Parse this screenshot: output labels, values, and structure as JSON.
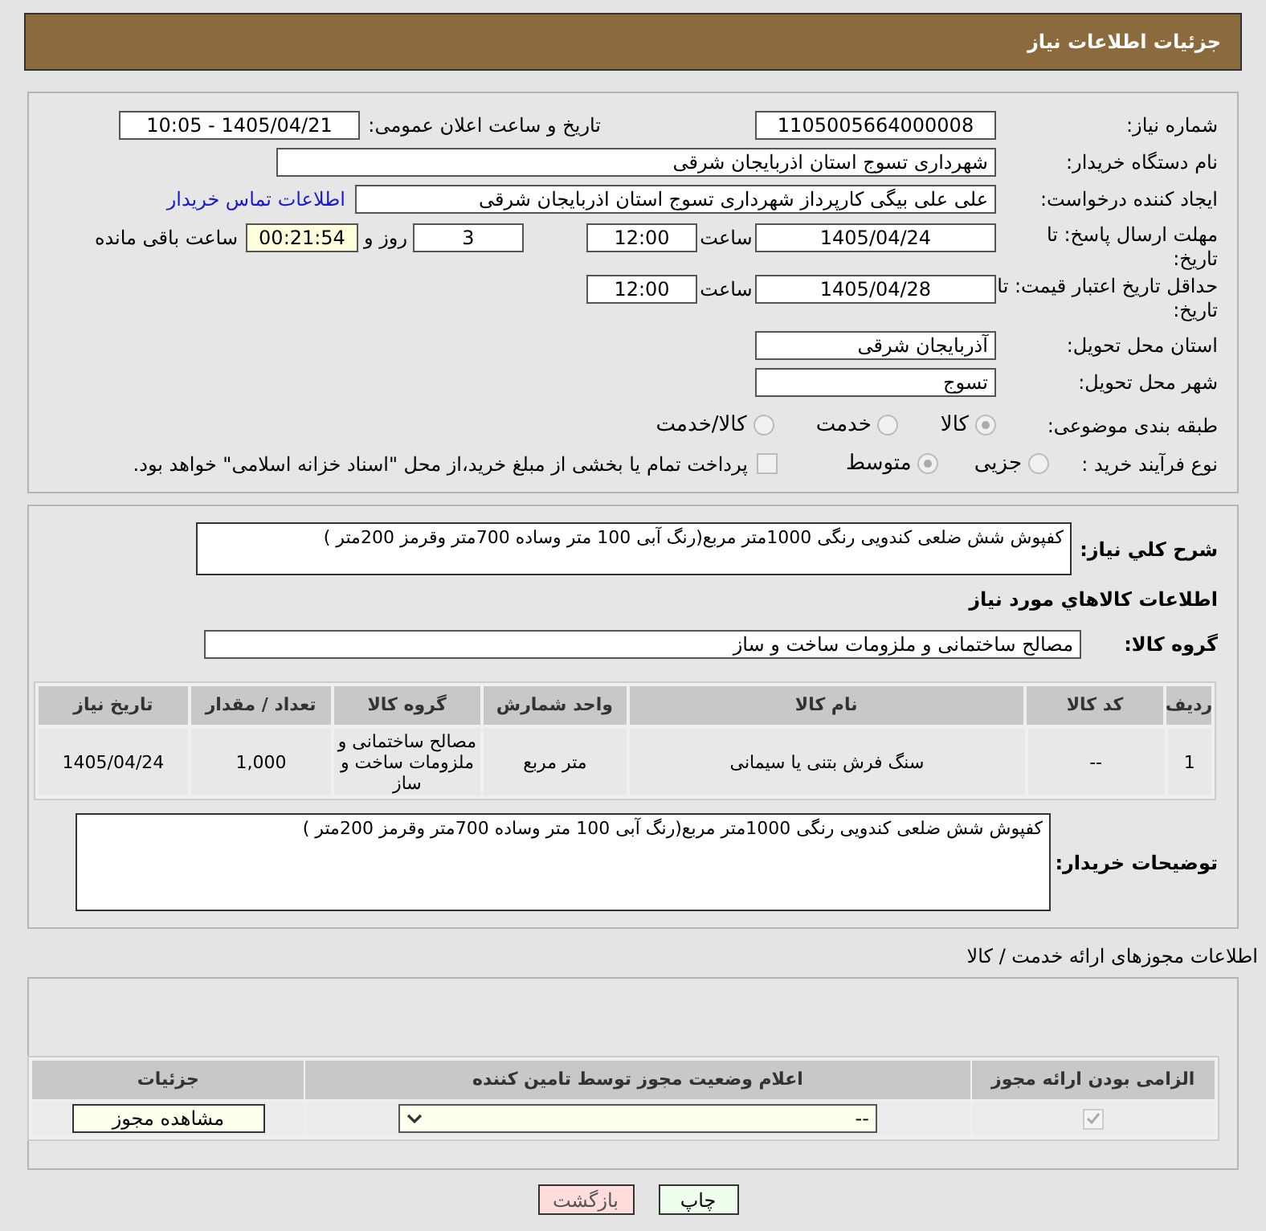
{
  "header": {
    "title": "جزئیات اطلاعات نیاز"
  },
  "need_number": {
    "label": "شماره نیاز:",
    "value": "1105005664000008"
  },
  "announce": {
    "label": "تاریخ و ساعت اعلان عمومی:",
    "value": "1405/04/21 - 10:05"
  },
  "buyer": {
    "label": "نام دستگاه خریدار:",
    "value": "شهرداری تسوج استان اذربایجان شرقی"
  },
  "creator": {
    "label": "ایجاد کننده درخواست:",
    "value": "علی علی بیگی کارپرداز شهرداری تسوج استان اذربایجان شرقی",
    "link": "اطلاعات تماس خریدار"
  },
  "deadline": {
    "label": "مهلت ارسال پاسخ: تا تاریخ:",
    "date": "1405/04/24",
    "time_label": "ساعت",
    "time": "12:00",
    "days": "3",
    "days_label": "روز و",
    "remaining": "00:21:54",
    "remaining_label": "ساعت باقی مانده"
  },
  "validity": {
    "label": "حداقل تاریخ اعتبار قیمت: تا تاریخ:",
    "date": "1405/04/28",
    "time_label": "ساعت",
    "time": "12:00"
  },
  "province": {
    "label": "استان محل تحویل:",
    "value": "آذربایجان شرقی"
  },
  "city": {
    "label": "شهر محل تحویل:",
    "value": "تسوج"
  },
  "category": {
    "label": "طبقه بندی موضوعی:",
    "options": [
      {
        "label": "کالا",
        "selected": true
      },
      {
        "label": "خدمت",
        "selected": false
      },
      {
        "label": "کالا/خدمت",
        "selected": false
      }
    ]
  },
  "process": {
    "label": "نوع فرآیند خرید :",
    "options": [
      {
        "label": "جزیی",
        "selected": false
      },
      {
        "label": "متوسط",
        "selected": true
      }
    ],
    "payment": {
      "label": "پرداخت تمام یا بخشی از مبلغ خرید،از محل \"اسناد خزانه اسلامی\" خواهد بود.",
      "checked": false
    }
  },
  "description": {
    "label": "شرح کلي نياز:",
    "value": "کفپوش شش ضلعی کندویی رنگی 1000متر مربع(رنگ آبی 100 متر وساده 700متر وقرمز 200متر )"
  },
  "goods_title": "اطلاعات کالاهاي مورد نياز",
  "goods_group": {
    "label": "گروه کالا:",
    "value": "مصالح ساختمانی و ملزومات ساخت و ساز"
  },
  "goods_table": {
    "columns": [
      "ردیف",
      "کد کالا",
      "نام کالا",
      "واحد شمارش",
      "گروه کالا",
      "تعداد / مقدار",
      "تاریخ نیاز"
    ],
    "rows": [
      [
        "1",
        "--",
        "سنگ فرش بتنی یا سیمانی",
        "متر مربع",
        "مصالح ساختمانی و ملزومات ساخت و ساز",
        "1,000",
        "1405/04/24"
      ]
    ]
  },
  "buyer_notes": {
    "label": "توضیحات خریدار:",
    "value": "کفپوش شش ضلعی کندویی رنگی 1000متر مربع(رنگ آبی 100 متر وساده 700متر وقرمز 200متر )"
  },
  "licenses_title": "اطلاعات مجوزهای ارائه خدمت / کالا",
  "licenses_table": {
    "columns": [
      "الزامی بودن ارائه مجوز",
      "اعلام وضعیت مجوز توسط تامین کننده",
      "جزئیات"
    ],
    "rows": [
      {
        "required": true,
        "status": "--",
        "button": "مشاهده مجوز"
      }
    ]
  },
  "buttons": {
    "print": "چاپ",
    "back": "بازگشت"
  }
}
